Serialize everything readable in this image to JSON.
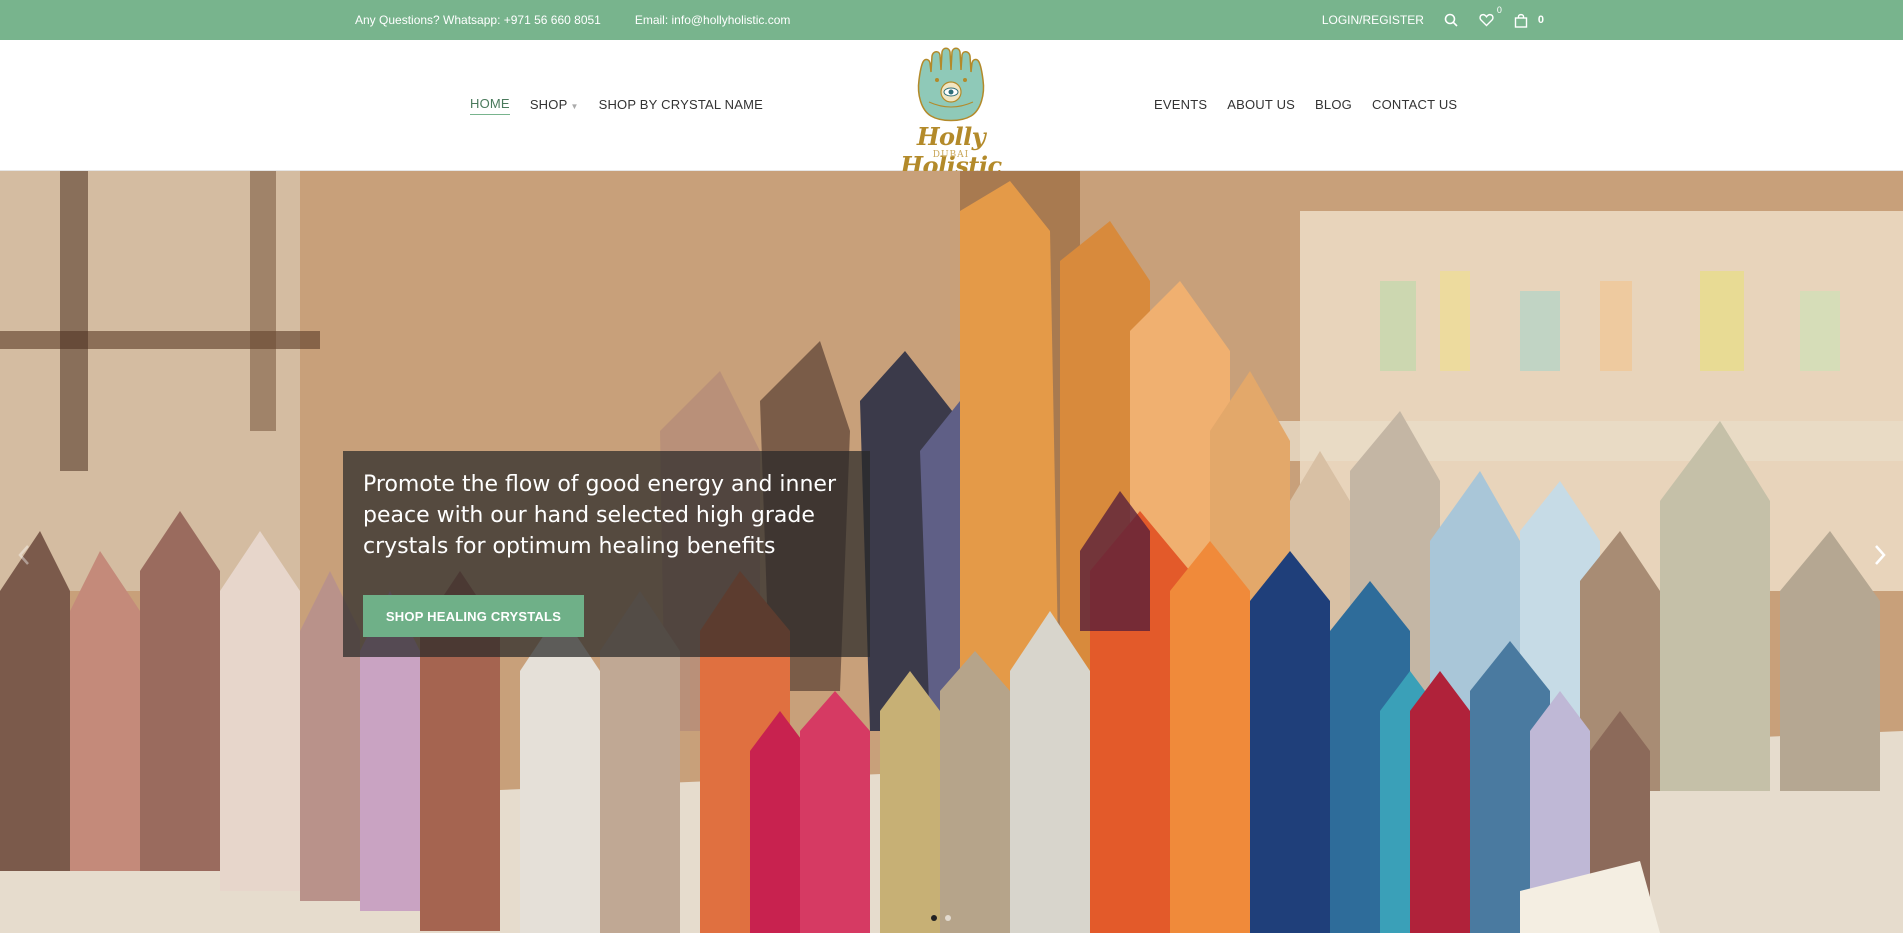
{
  "topbar": {
    "phone_text": "Any Questions?  Whatsapp: +971 56 660 8051",
    "email_text": "Email: info@hollyholistic.com",
    "login_label": "LOGIN/REGISTER",
    "wishlist_count": "0",
    "cart_count": "0",
    "background_color": "#78b48d",
    "icons": [
      "search-icon",
      "heart-icon",
      "shopping-bag-icon"
    ]
  },
  "nav": {
    "left": [
      {
        "label": "HOME",
        "active": true
      },
      {
        "label": "SHOP",
        "has_dropdown": true
      },
      {
        "label": "SHOP BY CRYSTAL NAME"
      }
    ],
    "right": [
      {
        "label": "EVENTS"
      },
      {
        "label": "ABOUT US"
      },
      {
        "label": "BLOG"
      },
      {
        "label": "CONTACT US"
      }
    ]
  },
  "logo": {
    "text": "Holly Holistic",
    "subtext": "DUBAI",
    "icon": "hamsa-hand-icon"
  },
  "hero": {
    "headline": "Promote the flow of good energy and inner peace with our hand selected high grade crystals for optimum healing benefits",
    "button_label": "SHOP HEALING CRYSTALS",
    "button_color": "#6fb088",
    "slide_count": 2,
    "active_slide": 1
  }
}
